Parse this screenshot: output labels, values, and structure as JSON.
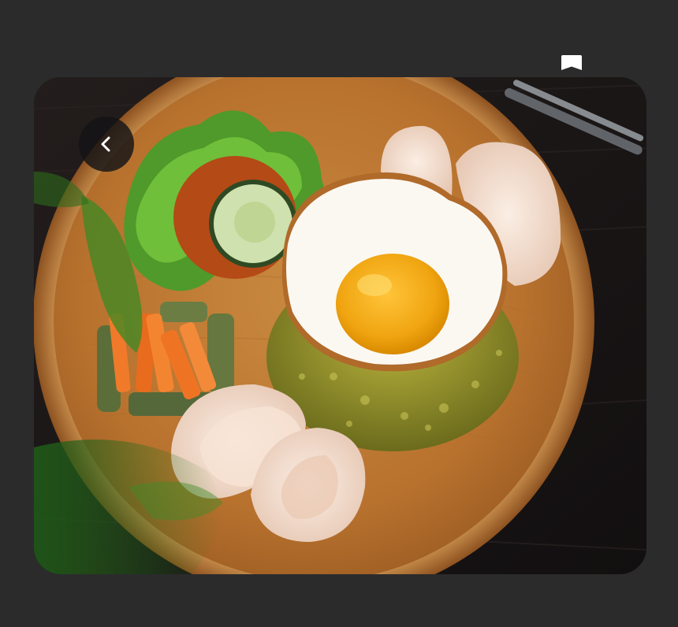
{
  "toolbar": {
    "bookmark_icon": "bookmark-icon",
    "back_icon": "chevron-left-icon"
  },
  "photo": {
    "subject": "food-photo",
    "description_hidden": true
  },
  "colors": {
    "background": "#2b2b2c",
    "back_button_bg": "#141416",
    "icon": "#ffffff"
  }
}
